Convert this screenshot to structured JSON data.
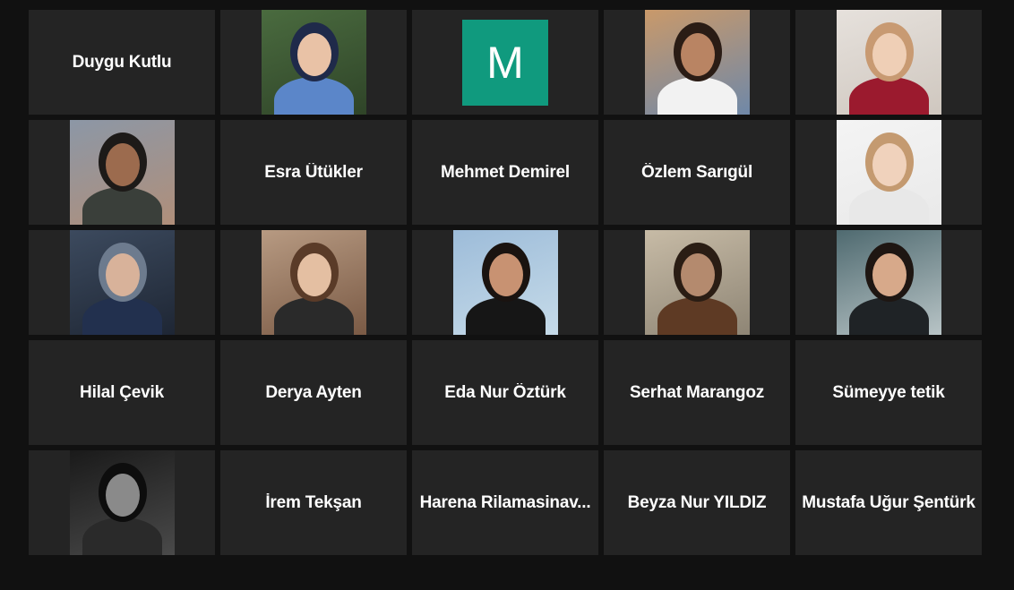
{
  "participants": [
    {
      "name": "Duygu Kutlu",
      "kind": "name"
    },
    {
      "kind": "photo",
      "photo": {
        "bg": "#4a6b3f",
        "bg2": "#2f4428",
        "skin": "#e9c2a6",
        "wrap": "#1f2a4a",
        "shirt": "#5b86c9"
      }
    },
    {
      "kind": "initial",
      "initial": "M",
      "color": "#109a7e"
    },
    {
      "kind": "photo",
      "photo": {
        "bg": "#c9996a",
        "bg2": "#6f88a8",
        "skin": "#b98463",
        "wrap": "#2a1c15",
        "shirt": "#f2f2f2"
      }
    },
    {
      "kind": "photo",
      "photo": {
        "bg": "#e6e1dc",
        "bg2": "#cfc7bf",
        "skin": "#efcfb6",
        "wrap": "#c89a72",
        "shirt": "#9b1a2e"
      }
    },
    {
      "kind": "photo",
      "photo": {
        "bg": "#8c97a6",
        "bg2": "#b08f7a",
        "skin": "#9c6b4e",
        "wrap": "#1d1a18",
        "shirt": "#3a3f3a"
      }
    },
    {
      "name": "Esra Ütükler",
      "kind": "name"
    },
    {
      "name": "Mehmet Demirel",
      "kind": "name"
    },
    {
      "name": "Özlem Sarıgül",
      "kind": "name"
    },
    {
      "kind": "photo",
      "photo": {
        "bg": "#f4f4f4",
        "bg2": "#e9e9e9",
        "skin": "#f0d2bc",
        "wrap": "#c49a70",
        "shirt": "#e8e8e8"
      }
    },
    {
      "kind": "photo",
      "photo": {
        "bg": "#3c4a5e",
        "bg2": "#1e2634",
        "skin": "#d8b29a",
        "wrap": "#6d7b8e",
        "shirt": "#22304e"
      }
    },
    {
      "kind": "photo",
      "photo": {
        "bg": "#b79a82",
        "bg2": "#7a5a45",
        "skin": "#e4bfa2",
        "wrap": "#5a3b28",
        "shirt": "#2a2a2a"
      }
    },
    {
      "kind": "photo",
      "photo": {
        "bg": "#9dbcd9",
        "bg2": "#c6dbe9",
        "skin": "#c89272",
        "wrap": "#1a1310",
        "shirt": "#161616"
      }
    },
    {
      "kind": "photo",
      "photo": {
        "bg": "#c7bba6",
        "bg2": "#8e8575",
        "skin": "#b48a6e",
        "wrap": "#2a1d14",
        "shirt": "#5e3a24"
      }
    },
    {
      "kind": "photo",
      "photo": {
        "bg": "#4f6a70",
        "bg2": "#b8c4c6",
        "skin": "#d7a98a",
        "wrap": "#1e1612",
        "shirt": "#1f2326"
      }
    },
    {
      "name": "Hilal Çevik",
      "kind": "name"
    },
    {
      "name": "Derya Ayten",
      "kind": "name"
    },
    {
      "name": "Eda Nur Öztürk",
      "kind": "name"
    },
    {
      "name": "Serhat Marangoz",
      "kind": "name"
    },
    {
      "name": "Sümeyye tetik",
      "kind": "name"
    },
    {
      "kind": "photo",
      "photo": {
        "bg": "#1a1a1a",
        "bg2": "#4a4a4a",
        "skin": "#8a8a8a",
        "wrap": "#0d0d0d",
        "shirt": "#2a2a2a"
      }
    },
    {
      "name": "İrem Tekşan",
      "kind": "name"
    },
    {
      "name": "Harena Rilamasinav...",
      "kind": "name"
    },
    {
      "name": "Beyza Nur YILDIZ",
      "kind": "name"
    },
    {
      "name": "Mustafa Uğur Şentürk",
      "kind": "name"
    }
  ]
}
